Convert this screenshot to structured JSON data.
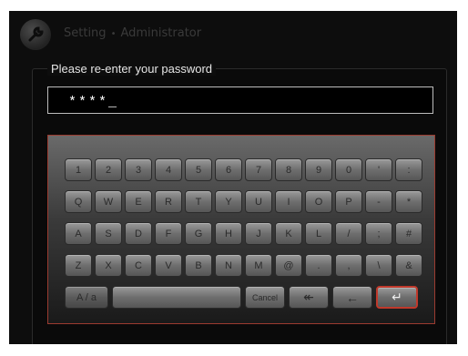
{
  "header": {
    "breadcrumb": [
      "Setting",
      "Administrator"
    ],
    "separator": "•"
  },
  "prompt": "Please re-enter your password",
  "password_display": "****_",
  "keyboard": {
    "rows": [
      [
        "1",
        "2",
        "3",
        "4",
        "5",
        "6",
        "7",
        "8",
        "9",
        "0",
        "'",
        ":"
      ],
      [
        "Q",
        "W",
        "E",
        "R",
        "T",
        "Y",
        "U",
        "I",
        "O",
        "P",
        "-",
        "*"
      ],
      [
        "A",
        "S",
        "D",
        "F",
        "G",
        "H",
        "J",
        "K",
        "L",
        "/",
        ";",
        "#"
      ],
      [
        "Z",
        "X",
        "C",
        "V",
        "B",
        "N",
        "M",
        "@",
        ".",
        ",",
        "\\",
        "&"
      ]
    ],
    "case_toggle": "A / a",
    "space": "",
    "cancel": "Cancel",
    "back_all": "↞",
    "backspace": "←",
    "enter": "↵"
  },
  "colors": {
    "background": "#0d0d0d",
    "enter_border": "#c0392b",
    "keyboard_border": "#9b3b30"
  }
}
